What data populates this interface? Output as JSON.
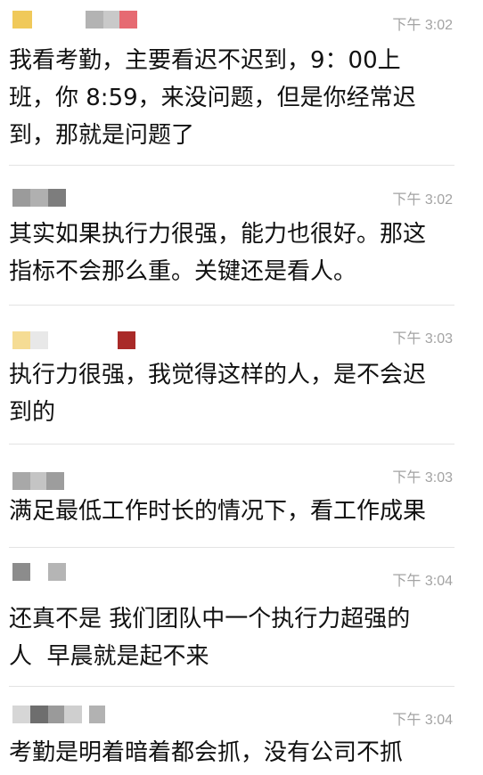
{
  "messages": [
    {
      "time": "下午 3:02",
      "text": "我看考勤，主要看迟不迟到，9：00上\n班，你 8:59，来没问题，但是你经常迟\n到，那就是问题了"
    },
    {
      "time": "下午 3:02",
      "text": "其实如果执行力很强，能力也很好。那这\n指标不会那么重。关键还是看人。"
    },
    {
      "time": "下午 3:03",
      "text": "执行力很强，我觉得这样的人，是不会迟\n到的"
    },
    {
      "time": "下午 3:03",
      "text": "满足最低工作时长的情况下，看工作成果"
    },
    {
      "time": "下午 3:04",
      "text": "还真不是 我们团队中一个执行力超强的\n人  早晨就是起不来"
    },
    {
      "time": "下午 3:04",
      "text": "考勤是明着暗着都会抓，没有公司不抓"
    }
  ],
  "colors": {
    "text": "#111111",
    "time": "#a3a3a3",
    "divider": "#e3e3e3"
  }
}
